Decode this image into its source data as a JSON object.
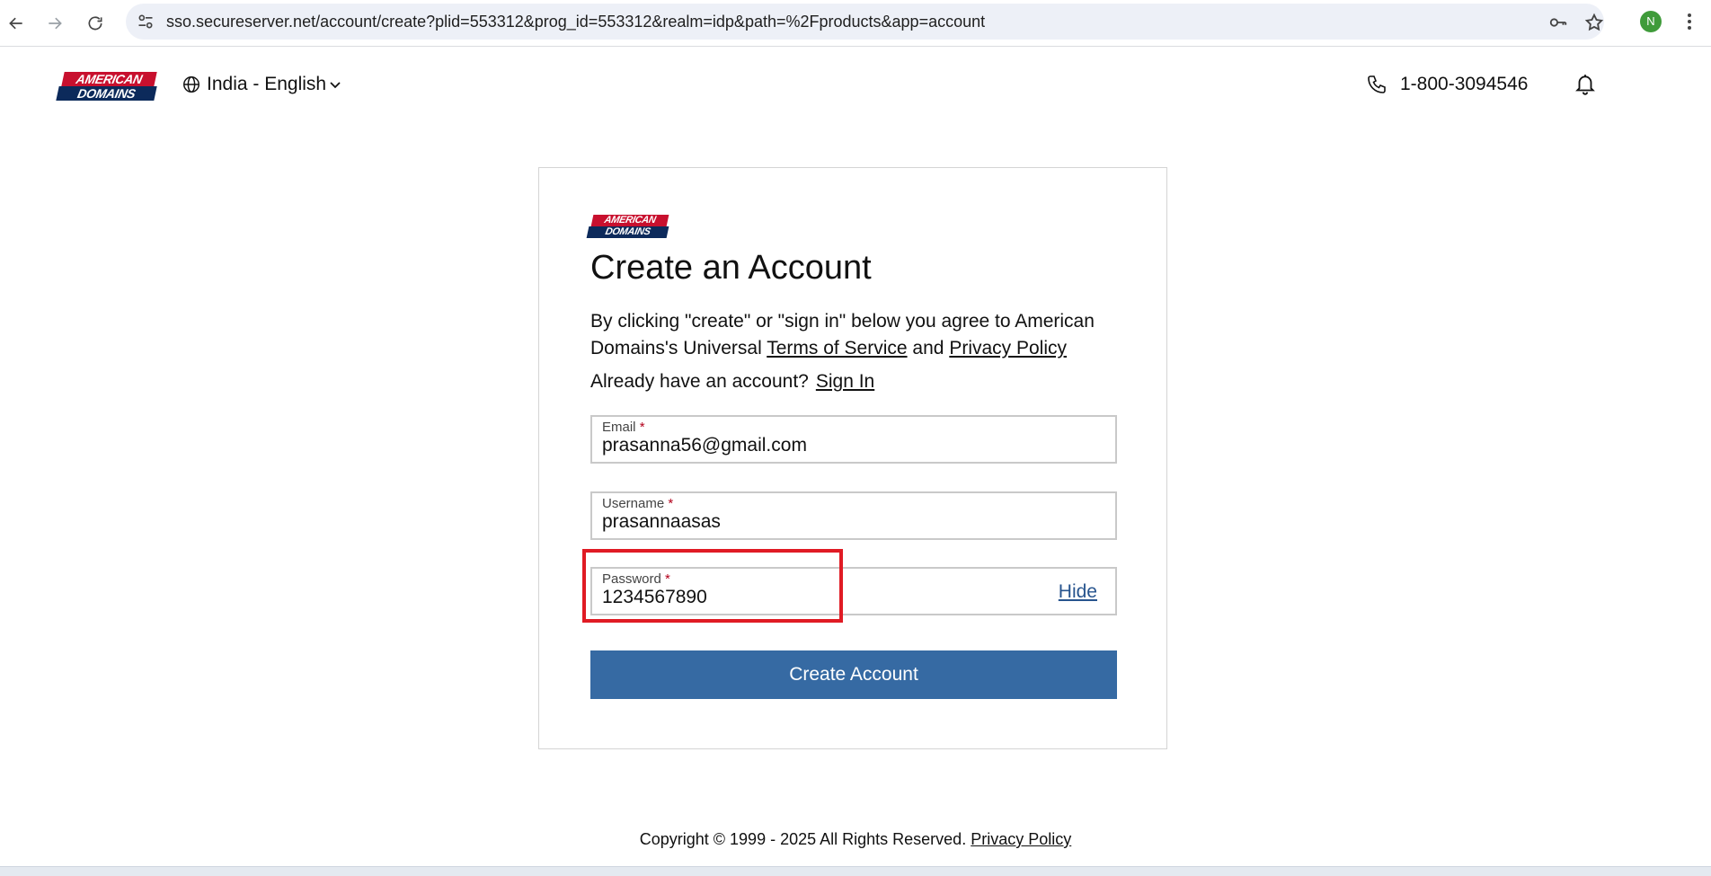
{
  "browser": {
    "url": "sso.secureserver.net/account/create?plid=553312&prog_id=553312&realm=idp&path=%2Fproducts&app=account",
    "profile_initial": "N"
  },
  "header": {
    "logo_line1": "AMERICAN",
    "logo_line2": "DOMAINS",
    "language": "India - English",
    "phone": "1-800-3094546"
  },
  "card": {
    "title": "Create an Account",
    "intro_text": "By clicking \"create\" or \"sign in\" below you agree to American Domains's Universal",
    "terms_link": "Terms of Service",
    "and_text": "and",
    "privacy_link": "Privacy Policy",
    "signin_prompt": "Already have an account?",
    "signin_link": "Sign In",
    "fields": {
      "email": {
        "label": "Email",
        "value": "prasanna56@gmail.com"
      },
      "username": {
        "label": "Username",
        "value": "prasannaasas"
      },
      "password": {
        "label": "Password",
        "value": "1234567890",
        "toggle": "Hide"
      }
    },
    "required_marker": "*",
    "submit_label": "Create Account"
  },
  "footer": {
    "copyright": "Copyright © 1999 - 2025 All Rights Reserved.",
    "privacy_link": "Privacy Policy"
  },
  "colors": {
    "brand_red": "#c8102e",
    "brand_navy": "#0c2a5b",
    "button_blue": "#366aa3",
    "highlight_red": "#e01b24"
  }
}
